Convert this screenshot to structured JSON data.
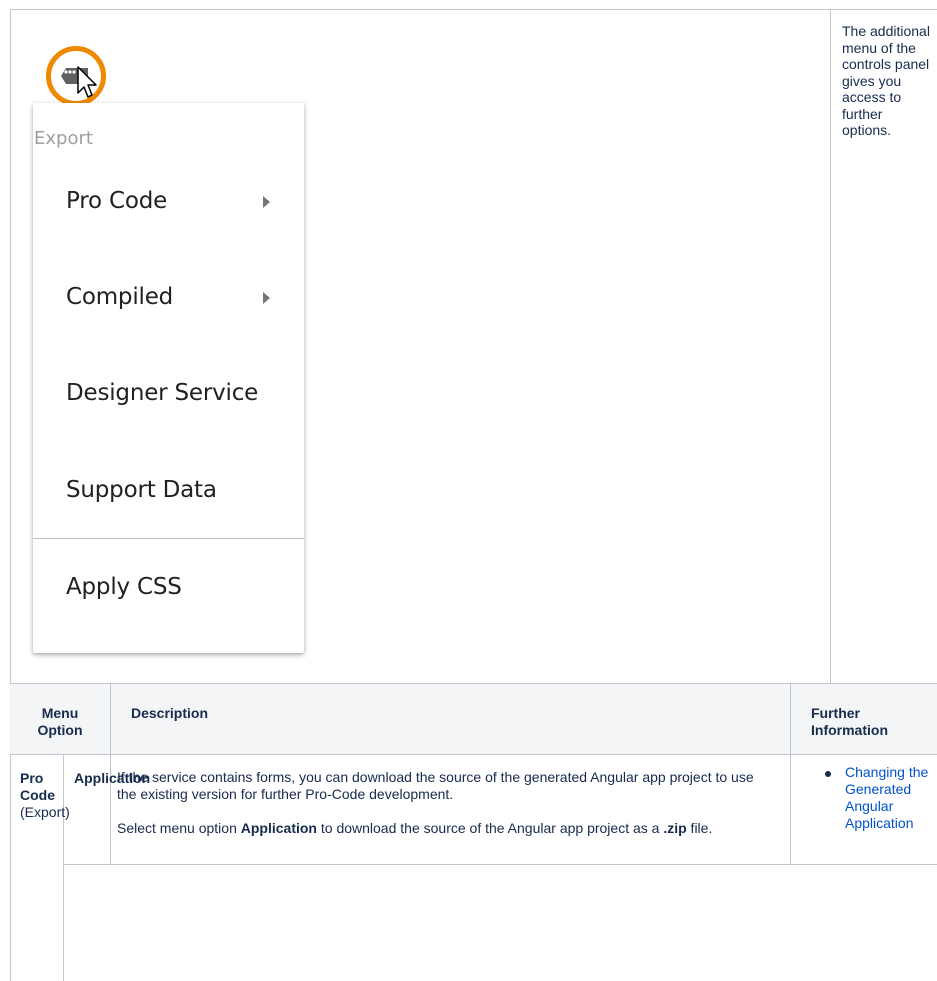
{
  "top_panel": {
    "side_note": "The additional menu of the controls panel gives you access to further options."
  },
  "icons": {
    "gear": "gear-icon",
    "cursor": "cursor-icon",
    "highlight_color": "#ef8a00"
  },
  "menu": {
    "header": "Export",
    "items": [
      {
        "label": "Pro Code",
        "has_submenu": true
      },
      {
        "label": "Compiled",
        "has_submenu": true
      },
      {
        "label": "Designer Service",
        "has_submenu": false
      },
      {
        "label": "Support Data",
        "has_submenu": false
      },
      {
        "label": "Apply CSS",
        "has_submenu": false
      }
    ]
  },
  "table": {
    "headers": {
      "menu_option": "Menu Option",
      "description": "Description",
      "further_information": "Further Information"
    },
    "rows": [
      {
        "option_main": "Pro Code",
        "option_sub": "(Export)",
        "sub_option": "Application",
        "description_p1": "If the service contains forms, you can download the source of the generated Angular app project to use the existing version for further Pro-Code development.",
        "description_p2_pre": "Select menu option ",
        "description_p2_bold1": "Application",
        "description_p2_mid": " to download the source of the Angular app project as a ",
        "description_p2_bold2": ".zip",
        "description_p2_post": " file.",
        "link": "Changing the Generated Angular Application"
      }
    ]
  }
}
